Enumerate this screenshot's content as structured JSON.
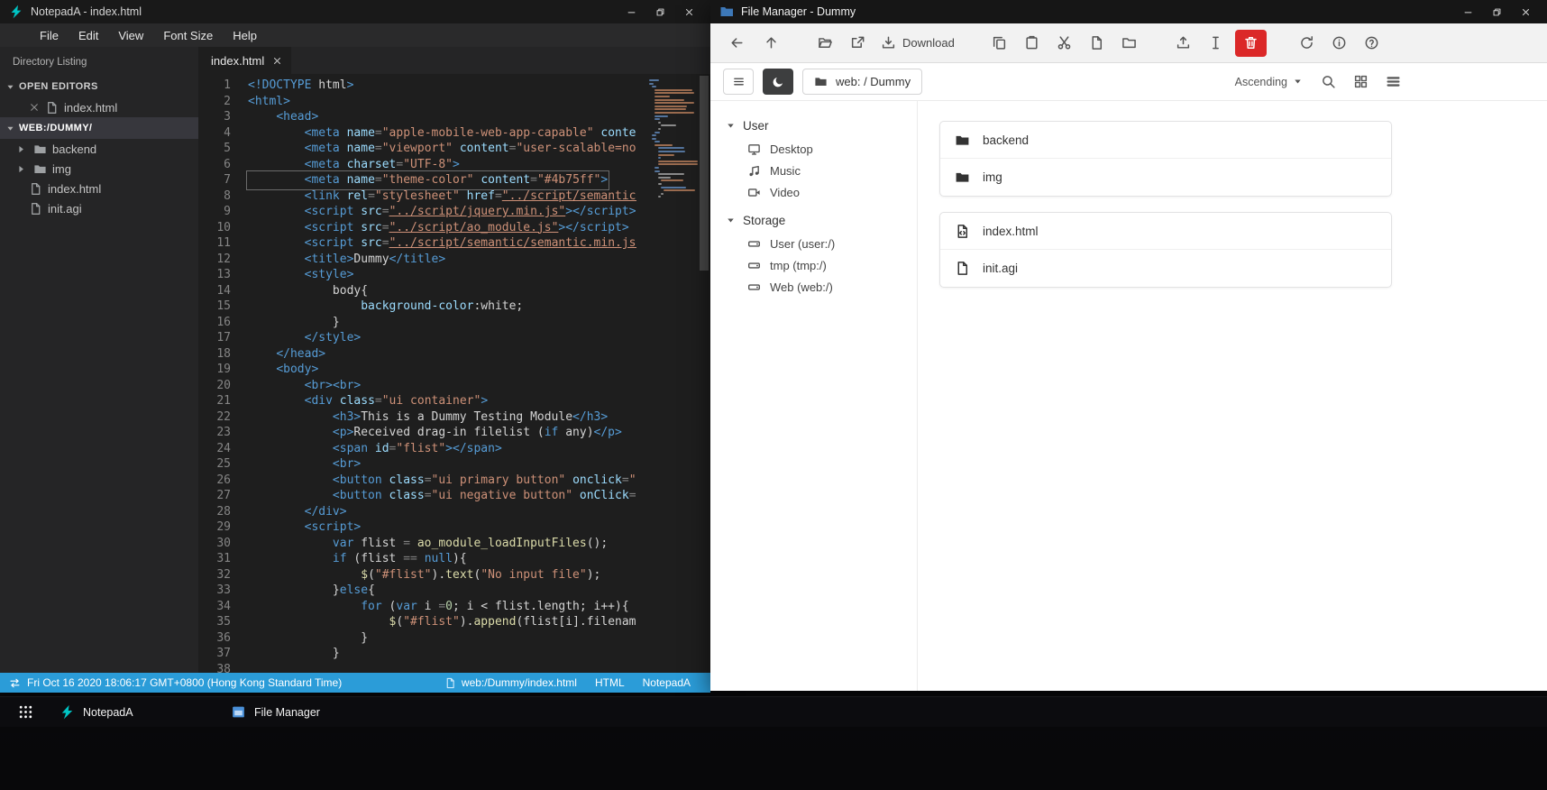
{
  "colors": {
    "statusbar_blue": "#2b9cd8",
    "danger_red": "#db2828",
    "notepada_teal": "#00c4c4",
    "filemanager_blue": "#3d78b8",
    "editor_background": "#1e1e1e"
  },
  "notepada": {
    "title": "NotepadA - index.html",
    "menu_items": [
      "File",
      "Edit",
      "View",
      "Font Size",
      "Help"
    ],
    "sidebar": {
      "header": "Directory Listing",
      "open_editors_label": "OPEN EDITORS",
      "open_editors": [
        {
          "icon": "file",
          "name": "index.html"
        }
      ],
      "workspace_label": "WEB:/DUMMY/",
      "tree": [
        {
          "icon": "folder",
          "name": "backend",
          "expandable": true
        },
        {
          "icon": "folder",
          "name": "img",
          "expandable": true
        },
        {
          "icon": "file",
          "name": "index.html",
          "expandable": false
        },
        {
          "icon": "file",
          "name": "init.agi",
          "expandable": false
        }
      ]
    },
    "tab": {
      "name": "index.html"
    },
    "active_line": 7,
    "code_lines": [
      "<!DOCTYPE html>",
      "<html>",
      "    <head>",
      "        <meta name=\"apple-mobile-web-app-capable\" content=\"yes\">",
      "        <meta name=\"viewport\" content=\"user-scalable=no, width=device-width\">",
      "        <meta charset=\"UTF-8\">",
      "        <meta name=\"theme-color\" content=\"#4b75ff\">",
      "        <link rel=\"stylesheet\" href=\"../script/semantic/semantic.min.css\">",
      "        <script src=\"../script/jquery.min.js\"></script>",
      "        <script src=\"../script/ao_module.js\"></script>",
      "        <script src=\"../script/semantic/semantic.min.js\"></script>",
      "        <title>Dummy</title>",
      "        <style>",
      "            body{",
      "                background-color:white;",
      "            }",
      "        </style>",
      "    </head>",
      "    <body>",
      "        <br><br>",
      "        <div class=\"ui container\">",
      "            <h3>This is a Dummy Testing Module</h3>",
      "            <p>Received drag-in filelist (if any)</p>",
      "            <span id=\"flist\"></span>",
      "            <br>",
      "            <button class=\"ui primary button\" onclick=\"openFileSelector()\">Open</button>",
      "            <button class=\"ui negative button\" onClick=\"ao_module_close()\">Close</button>",
      "        </div>",
      "        <script>",
      "            var flist = ao_module_loadInputFiles();",
      "            if (flist == null){",
      "                $(\"#flist\").text(\"No input file\");",
      "            }else{",
      "                for (var i =0; i < flist.length; i++){",
      "                    $(\"#flist\").append(flist[i].filename + \"<br>\");",
      "                }",
      "            }",
      ""
    ],
    "statusbar": {
      "time": "Fri Oct 16 2020 18:06:17 GMT+0800 (Hong Kong Standard Time)",
      "file_path": "web:/Dummy/index.html",
      "language": "HTML",
      "app_name": "NotepadA"
    }
  },
  "filemanager": {
    "title": "File Manager - Dummy",
    "toolbar": {
      "nav": [
        {
          "icon": "arrow-left"
        },
        {
          "icon": "arrow-up"
        }
      ],
      "groups": [
        [
          {
            "icon": "folder-open"
          },
          {
            "icon": "external-link"
          },
          {
            "icon": "download",
            "label": "Download"
          }
        ],
        [
          {
            "icon": "copy"
          },
          {
            "icon": "paste"
          },
          {
            "icon": "cut"
          },
          {
            "icon": "new-file"
          },
          {
            "icon": "new-folder"
          }
        ],
        [
          {
            "icon": "upload"
          },
          {
            "icon": "rename"
          },
          {
            "icon": "trash",
            "danger": true
          }
        ],
        [
          {
            "icon": "refresh"
          },
          {
            "icon": "info"
          },
          {
            "icon": "help"
          }
        ]
      ]
    },
    "pathbar": {
      "breadcrumb": "web: / Dummy",
      "sort_label": "Ascending",
      "tools": [
        "search",
        "grid",
        "list"
      ]
    },
    "sidebar": [
      {
        "label": "User",
        "items": [
          {
            "icon": "desktop",
            "label": "Desktop"
          },
          {
            "icon": "music",
            "label": "Music"
          },
          {
            "icon": "video",
            "label": "Video"
          }
        ]
      },
      {
        "label": "Storage",
        "items": [
          {
            "icon": "drive",
            "label": "User (user:/)"
          },
          {
            "icon": "drive",
            "label": "tmp (tmp:/)"
          },
          {
            "icon": "drive",
            "label": "Web (web:/)"
          }
        ]
      }
    ],
    "file_groups": [
      [
        {
          "icon": "folder",
          "name": "backend"
        },
        {
          "icon": "folder",
          "name": "img"
        }
      ],
      [
        {
          "icon": "file-code",
          "name": "index.html"
        },
        {
          "icon": "file",
          "name": "init.agi"
        }
      ]
    ]
  },
  "taskbar": {
    "items": [
      {
        "icon": "apps",
        "label": ""
      },
      {
        "icon": "notepada-logo",
        "label": "NotepadA"
      },
      {
        "icon": "filemanager-logo",
        "label": "File Manager"
      }
    ]
  }
}
